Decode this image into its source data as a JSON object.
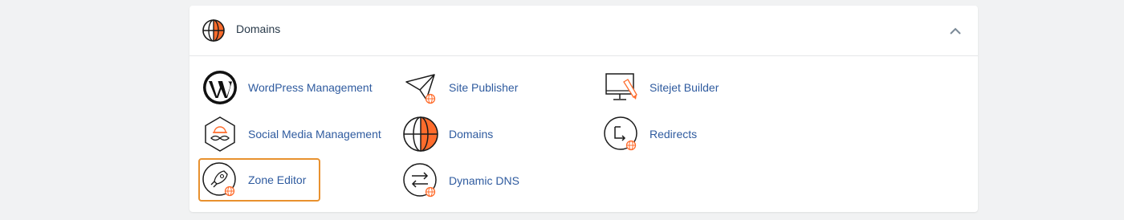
{
  "section": {
    "title": "Domains",
    "accent_color": "#ff6c2c",
    "icon": "globe-icon",
    "collapse_icon": "chevron-up-icon"
  },
  "items": [
    {
      "label": "WordPress Management",
      "icon": "wordpress-icon"
    },
    {
      "label": "Site Publisher",
      "icon": "paper-plane-icon"
    },
    {
      "label": "Sitejet Builder",
      "icon": "monitor-pencil-icon"
    },
    {
      "label": "Social Media Management",
      "icon": "hexagon-social-icon"
    },
    {
      "label": "Domains",
      "icon": "globe-icon"
    },
    {
      "label": "Redirects",
      "icon": "redirect-icon"
    },
    {
      "label": "Zone Editor",
      "icon": "rocket-icon",
      "selected": true
    },
    {
      "label": "Dynamic DNS",
      "icon": "swap-arrows-icon"
    }
  ]
}
